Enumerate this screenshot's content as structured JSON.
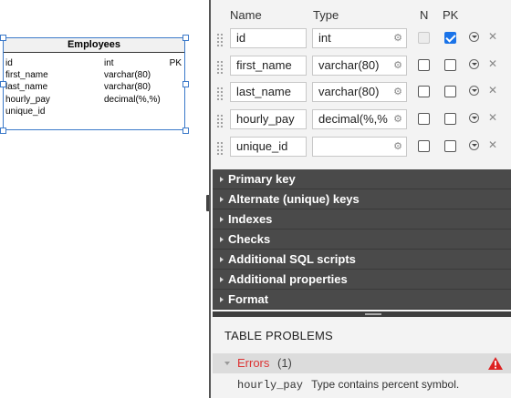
{
  "entity": {
    "title": "Employees",
    "rows": [
      {
        "name": "id",
        "type": "int",
        "key": "PK"
      },
      {
        "name": "first_name",
        "type": "varchar(80)",
        "key": ""
      },
      {
        "name": "last_name",
        "type": "varchar(80)",
        "key": ""
      },
      {
        "name": "hourly_pay",
        "type": "decimal(%,%)",
        "key": ""
      },
      {
        "name": "unique_id",
        "type": "",
        "key": ""
      }
    ]
  },
  "grid": {
    "headers": {
      "name": "Name",
      "type": "Type",
      "n": "N",
      "pk": "PK"
    },
    "rows": [
      {
        "name": "id",
        "type": "int",
        "n": false,
        "n_disabled": true,
        "pk": true
      },
      {
        "name": "first_name",
        "type": "varchar(80)",
        "n": false,
        "n_disabled": false,
        "pk": false
      },
      {
        "name": "last_name",
        "type": "varchar(80)",
        "n": false,
        "n_disabled": false,
        "pk": false
      },
      {
        "name": "hourly_pay",
        "type": "decimal(%,%",
        "n": false,
        "n_disabled": false,
        "pk": false
      },
      {
        "name": "unique_id",
        "type": "",
        "n": false,
        "n_disabled": false,
        "pk": false
      }
    ],
    "icons": {
      "type_settings": "gear-icon",
      "row_menu": "chevron-down-circle-icon",
      "delete": "close-icon"
    }
  },
  "sections": [
    "Primary key",
    "Alternate (unique) keys",
    "Indexes",
    "Checks",
    "Additional SQL scripts",
    "Additional properties",
    "Format"
  ],
  "problems": {
    "title": "TABLE PROBLEMS",
    "errors_label": "Errors",
    "errors_count": "(1)",
    "items": [
      {
        "column": "hourly_pay",
        "message": "Type contains percent symbol."
      }
    ]
  },
  "colors": {
    "selection": "#3b79c9",
    "section_bg": "#4a4a4a",
    "error": "#dd3333",
    "checked": "#1a73e8"
  }
}
